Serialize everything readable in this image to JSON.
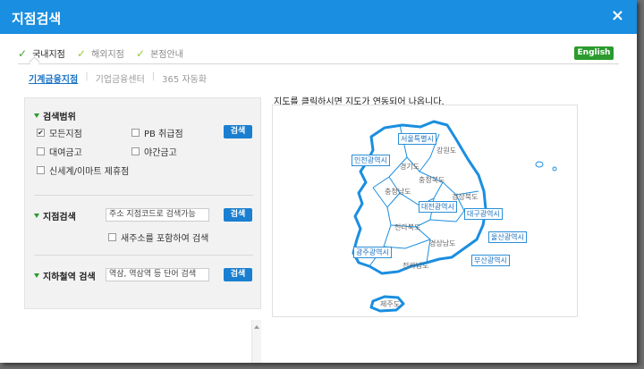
{
  "window": {
    "title": "지점검색",
    "close_icon": "×"
  },
  "tabs": [
    {
      "label": "국내지점",
      "active": true
    },
    {
      "label": "해외지점",
      "active": false
    },
    {
      "label": "본점안내",
      "active": false
    }
  ],
  "english_button": "English",
  "subtabs": [
    "기계금융지점",
    "기업금융센터",
    "365 자동화"
  ],
  "sections": {
    "range": {
      "title": "검색범위",
      "options": [
        {
          "label": "모든지점",
          "checked": true
        },
        {
          "label": "PB 취급점",
          "checked": false
        },
        {
          "label": "대여금고",
          "checked": false
        },
        {
          "label": "야간금고",
          "checked": false
        },
        {
          "label": "신세계/이마트 제휴점",
          "checked": false
        }
      ],
      "button": "검색"
    },
    "branch": {
      "title": "지점검색",
      "input_value": "주소 지점코드로 검색가능",
      "option": "새주소를 포함하여 검색",
      "button": "검색"
    },
    "subway": {
      "title": "지하철역 검색",
      "input_value": "역삼, 역삼역 등 단어 검색",
      "button": "검색"
    }
  },
  "map": {
    "caption": "지도를 클릭하시면 지도가 연동되어 나옵니다.",
    "regions": [
      "강원도",
      "경기도",
      "충청북도",
      "충청남도",
      "경상북도",
      "전라북도",
      "경상남도",
      "전라남도",
      "제주도"
    ],
    "cities": [
      "서울특별시",
      "인천광역시",
      "대전광역시",
      "대구광역시",
      "광주광역시",
      "울산광역시",
      "부산광역시"
    ],
    "accent": "#1a8ee0"
  }
}
